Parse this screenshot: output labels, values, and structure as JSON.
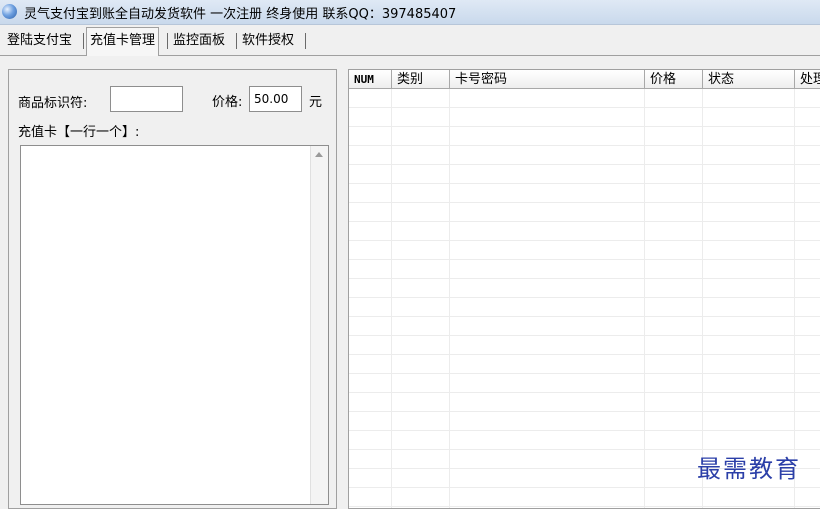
{
  "window": {
    "title": "灵气支付宝到账全自动发货软件    一次注册 终身使用    联系QQ：397485407",
    "icon": "app-globe-icon"
  },
  "tabs": [
    {
      "label": "登陆支付宝",
      "active": false
    },
    {
      "label": "充值卡管理",
      "active": true
    },
    {
      "label": "监控面板",
      "active": false
    },
    {
      "label": "软件授权",
      "active": false
    }
  ],
  "form": {
    "product_id_label": "商品标识符:",
    "product_id_value": "",
    "price_label": "价格:",
    "price_value": "50.00",
    "price_unit": "元",
    "cards_label": "充值卡【一行一个】:",
    "cards_value": ""
  },
  "grid": {
    "columns": [
      "NUM",
      "类别",
      "卡号密码",
      "价格",
      "状态",
      "处理"
    ],
    "rows": []
  },
  "watermark": "最需教育"
}
